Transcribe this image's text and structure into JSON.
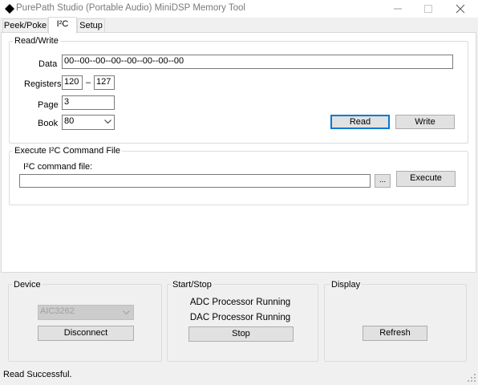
{
  "window": {
    "title": "PurePath Studio (Portable Audio) MiniDSP Memory Tool",
    "controls": {
      "minimize": "—",
      "maximize": "☐",
      "close": "✕"
    }
  },
  "tabs": [
    {
      "label": "Peek/Poke",
      "active": false
    },
    {
      "label": "I²C",
      "active": true
    },
    {
      "label": "Setup",
      "active": false
    }
  ],
  "read_write": {
    "title": "Read/Write",
    "data_label": "Data",
    "data_value": "00--00--00--00--00--00--00--00",
    "registers_label": "Registers",
    "register_start": "120",
    "register_separator": "–",
    "register_end": "127",
    "page_label": "Page",
    "page_value": "3",
    "book_label": "Book",
    "book_value": "80",
    "read_button": "Read",
    "write_button": "Write"
  },
  "execute": {
    "title": "Execute I²C Command File",
    "file_label": "I²C command file:",
    "file_value": "",
    "browse_button": "...",
    "execute_button": "Execute"
  },
  "device": {
    "title": "Device",
    "selected": "AIC3262",
    "disconnect_button": "Disconnect"
  },
  "start_stop": {
    "title": "Start/Stop",
    "adc_status": "ADC Processor Running",
    "dac_status": "DAC Processor Running",
    "stop_button": "Stop"
  },
  "display": {
    "title": "Display",
    "refresh_button": "Refresh"
  },
  "status_bar": {
    "text": "Read Successful."
  },
  "colors": {
    "accent": "#0078d7",
    "window_bg": "#f0f0f0",
    "panel_bg": "#ffffff"
  }
}
